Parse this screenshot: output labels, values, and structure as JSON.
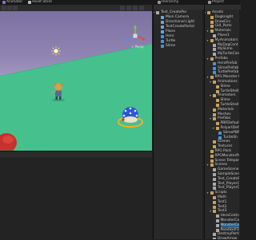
{
  "tabs": [
    {
      "label": "Animator"
    },
    {
      "label": "Asset Store"
    },
    {
      "label": "Hierarchy"
    },
    {
      "label": "Project"
    }
  ],
  "scene": {
    "view_label": "< Persp"
  },
  "hierarchy": {
    "items": [
      {
        "label": "Test_CreatePor",
        "depth": 0,
        "icon": "unity-scene-icon",
        "expanded": true
      },
      {
        "label": "Main Camera",
        "depth": 1,
        "icon": "cube-icon"
      },
      {
        "label": "Directional Light",
        "depth": 1,
        "icon": "cube-icon"
      },
      {
        "label": "TestCreatePortal",
        "depth": 1,
        "icon": "cube-icon"
      },
      {
        "label": "Plane",
        "depth": 1,
        "icon": "cube-icon"
      },
      {
        "label": "Hero",
        "depth": 1,
        "icon": "cube-blue-icon"
      },
      {
        "label": "Turtle",
        "depth": 1,
        "icon": "cube-blue-icon"
      },
      {
        "label": "Slime",
        "depth": 1,
        "icon": "cube-blue-icon"
      }
    ]
  },
  "project": {
    "items": [
      {
        "label": "Assets",
        "depth": 0,
        "icon": "folder-icon",
        "expanded": true
      },
      {
        "label": "Dogknight",
        "depth": 1,
        "icon": "folder-icon"
      },
      {
        "label": "DrawCirc",
        "depth": 1,
        "icon": "folder-icon"
      },
      {
        "label": "GUI_Parts",
        "depth": 1,
        "icon": "folder-icon"
      },
      {
        "label": "Materials",
        "depth": 1,
        "icon": "folder-icon",
        "expanded": true
      },
      {
        "label": "Plane1",
        "depth": 2,
        "icon": "file-icon"
      },
      {
        "label": "MyAnimators",
        "depth": 1,
        "icon": "folder-icon",
        "expanded": true
      },
      {
        "label": "MyDogCont",
        "depth": 2,
        "icon": "file-icon"
      },
      {
        "label": "MySlime",
        "depth": 2,
        "icon": "file-icon"
      },
      {
        "label": "MyTurtleCont",
        "depth": 2,
        "icon": "file-icon"
      },
      {
        "label": "Prefabs",
        "depth": 1,
        "icon": "folder-icon",
        "expanded": true
      },
      {
        "label": "HeroPrefab",
        "depth": 2,
        "icon": "cube-blue-icon"
      },
      {
        "label": "SlimePrefab",
        "depth": 2,
        "icon": "cube-blue-icon"
      },
      {
        "label": "TurtlePrefab",
        "depth": 2,
        "icon": "cube-blue-icon"
      },
      {
        "label": "RPG Monster Du",
        "depth": 1,
        "icon": "folder-icon",
        "expanded": true
      },
      {
        "label": "Animations",
        "depth": 2,
        "icon": "folder-icon",
        "expanded": true
      },
      {
        "label": "Slime",
        "depth": 3,
        "icon": "folder-icon"
      },
      {
        "label": "TurtleShell",
        "depth": 3,
        "icon": "folder-icon"
      },
      {
        "label": "Animators",
        "depth": 2,
        "icon": "folder-icon",
        "expanded": true
      },
      {
        "label": "Slime",
        "depth": 3,
        "icon": "folder-icon"
      },
      {
        "label": "TurtleShell",
        "depth": 3,
        "icon": "folder-icon"
      },
      {
        "label": "Materials",
        "depth": 2,
        "icon": "folder-icon"
      },
      {
        "label": "Meshes",
        "depth": 2,
        "icon": "folder-icon"
      },
      {
        "label": "Prefabs",
        "depth": 2,
        "icon": "folder-icon",
        "expanded": true
      },
      {
        "label": "PBRDefault",
        "depth": 3,
        "icon": "folder-icon"
      },
      {
        "label": "PolyartDefa",
        "depth": 3,
        "icon": "folder-icon",
        "expanded": true
      },
      {
        "label": "SlimePBR",
        "depth": 4,
        "icon": "cube-blue-icon"
      },
      {
        "label": "TurtleSh",
        "depth": 4,
        "icon": "cube-blue-icon"
      },
      {
        "label": "Scenes",
        "depth": 2,
        "icon": "folder-icon"
      },
      {
        "label": "Textures",
        "depth": 2,
        "icon": "folder-icon"
      },
      {
        "label": "RPG Pack",
        "depth": 1,
        "icon": "folder-icon"
      },
      {
        "label": "RPGMonsterPar",
        "depth": 1,
        "icon": "folder-icon"
      },
      {
        "label": "Scene Teleport",
        "depth": 1,
        "icon": "folder-icon"
      },
      {
        "label": "Scenes",
        "depth": 1,
        "icon": "folder-icon",
        "expanded": true
      },
      {
        "label": "GameScene",
        "depth": 2,
        "icon": "unity-scene-icon"
      },
      {
        "label": "SampleScene",
        "depth": 2,
        "icon": "unity-scene-icon"
      },
      {
        "label": "Test_CreatePo",
        "depth": 2,
        "icon": "unity-scene-icon"
      },
      {
        "label": "Test_PlayerCo",
        "depth": 2,
        "icon": "unity-scene-icon"
      },
      {
        "label": "Test_PlayerCo",
        "depth": 2,
        "icon": "unity-scene-icon"
      },
      {
        "label": "Scripts",
        "depth": 1,
        "icon": "folder-icon",
        "expanded": true
      },
      {
        "label": "Math",
        "depth": 2,
        "icon": "folder-icon"
      },
      {
        "label": "Test1",
        "depth": 2,
        "icon": "folder-icon"
      },
      {
        "label": "Test2",
        "depth": 2,
        "icon": "folder-icon"
      },
      {
        "label": "Test3",
        "depth": 2,
        "icon": "folder-icon",
        "expanded": true
      },
      {
        "label": "HeroControl",
        "depth": 3,
        "icon": "script-icon"
      },
      {
        "label": "MonsterCo",
        "depth": 3,
        "icon": "script-icon"
      },
      {
        "label": "MonsterCo",
        "depth": 3,
        "icon": "script-icon",
        "selected": true
      },
      {
        "label": "ReadSkillTa",
        "depth": 3,
        "icon": "script-icon"
      },
      {
        "label": "DestroyParticl",
        "depth": 2,
        "icon": "script-icon"
      },
      {
        "label": "DrawArrow",
        "depth": 2,
        "icon": "script-icon"
      }
    ]
  },
  "colors": {
    "ground": "#46c18e",
    "sky": "#8f84b2",
    "selection": "#2c5d87"
  }
}
